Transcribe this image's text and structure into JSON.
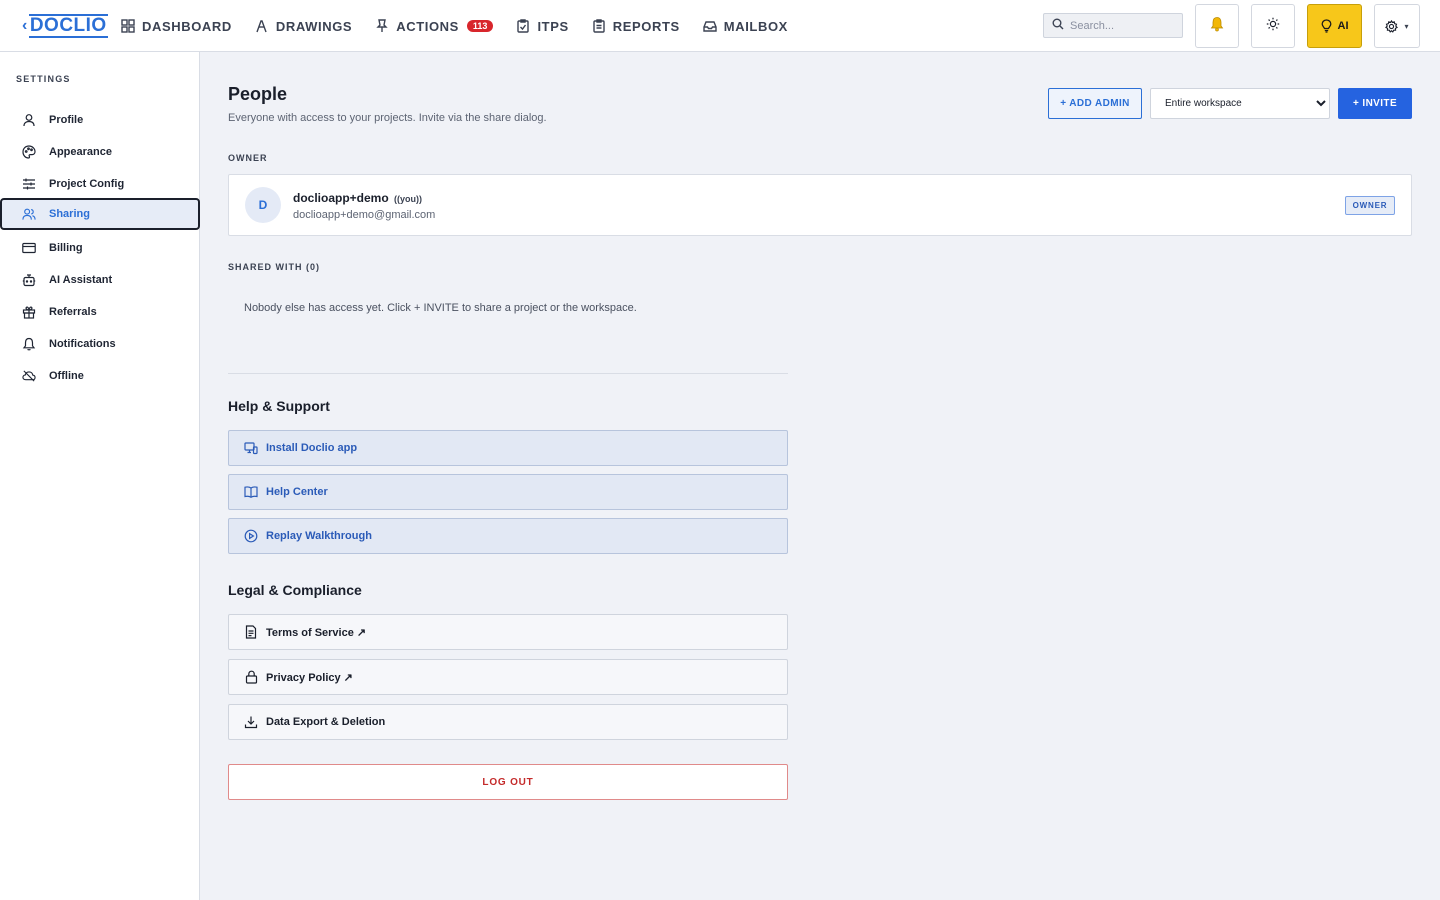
{
  "app": {
    "logo_prefix": "‹",
    "logo_text": "DOCLIO"
  },
  "nav": {
    "items": [
      {
        "label": "DASHBOARD",
        "icon": "grid-icon"
      },
      {
        "label": "DRAWINGS",
        "icon": "pen-icon"
      },
      {
        "label": "ACTIONS",
        "icon": "pin-icon",
        "badge": "113"
      },
      {
        "label": "ITPS",
        "icon": "clipboard-check-icon"
      },
      {
        "label": "REPORTS",
        "icon": "clipboard-icon"
      },
      {
        "label": "MAILBOX",
        "icon": "inbox-icon"
      }
    ]
  },
  "search": {
    "placeholder": "Search..."
  },
  "toolbar": {
    "ai_label": "AI",
    "ai_color": "#f7c71a",
    "gear_caret": "▾"
  },
  "sidebar": {
    "heading": "SETTINGS",
    "items": [
      {
        "label": "Profile",
        "icon": "user-icon"
      },
      {
        "label": "Appearance",
        "icon": "palette-icon"
      },
      {
        "label": "Project Config",
        "icon": "sliders-icon"
      },
      {
        "label": "Sharing",
        "icon": "users-icon",
        "active": true
      },
      {
        "label": "Billing",
        "icon": "credit-card-icon"
      },
      {
        "label": "AI Assistant",
        "icon": "bot-icon"
      },
      {
        "label": "Referrals",
        "icon": "gift-icon"
      },
      {
        "label": "Notifications",
        "icon": "bell-icon"
      },
      {
        "label": "Offline",
        "icon": "cloud-off-icon"
      }
    ]
  },
  "people": {
    "title": "People",
    "subtitle": "Everyone with access to your projects. Invite via the share dialog.",
    "add_admin_label": "+ ADD ADMIN",
    "scope_selected": "Entire workspace",
    "invite_label": "+ INVITE",
    "owner_section": "OWNER",
    "owner": {
      "initial": "D",
      "name": "doclioapp+demo",
      "you_tag": "((you))",
      "email": "doclioapp+demo@gmail.com",
      "badge": "OWNER"
    },
    "shared_section": "SHARED WITH (0)",
    "empty_message": "Nobody else has access yet. Click + INVITE to share a project or the workspace."
  },
  "help": {
    "title": "Help & Support",
    "items": [
      {
        "label": "Install Doclio app",
        "icon": "monitor-phone-icon"
      },
      {
        "label": "Help Center",
        "icon": "book-icon"
      },
      {
        "label": "Replay Walkthrough",
        "icon": "play-circle-icon"
      }
    ]
  },
  "legal": {
    "title": "Legal & Compliance",
    "items": [
      {
        "label": "Terms of Service ↗",
        "icon": "document-icon"
      },
      {
        "label": "Privacy Policy ↗",
        "icon": "lock-icon"
      },
      {
        "label": "Data Export & Deletion",
        "icon": "download-icon"
      }
    ]
  },
  "logout_label": "LOG OUT",
  "colors": {
    "accent": "#2563e0",
    "danger": "#c42a2a",
    "badge": "#d8262c"
  }
}
